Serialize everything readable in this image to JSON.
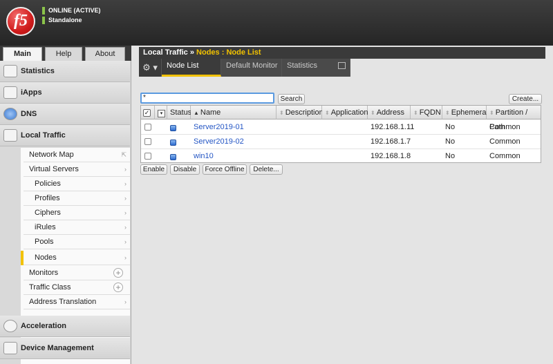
{
  "header": {
    "logo_text": "f5",
    "status": "ONLINE (ACTIVE)",
    "mode": "Standalone"
  },
  "left_tabs": [
    "Main",
    "Help",
    "About"
  ],
  "sidebar": {
    "sections": [
      {
        "label": "Statistics",
        "icon": "statistics-icon"
      },
      {
        "label": "iApps",
        "icon": "iapps-icon"
      },
      {
        "label": "DNS",
        "icon": "dns-globe-icon"
      },
      {
        "label": "Local Traffic",
        "icon": "local-traffic-icon"
      },
      {
        "label": "Acceleration",
        "icon": "acceleration-icon"
      },
      {
        "label": "Device Management",
        "icon": "device-management-icon"
      }
    ],
    "local_traffic_items": [
      {
        "label": "Network Map",
        "sub": false
      },
      {
        "label": "Virtual Servers",
        "sub": false
      },
      {
        "label": "Policies",
        "sub": true
      },
      {
        "label": "Profiles",
        "sub": true
      },
      {
        "label": "Ciphers",
        "sub": true
      },
      {
        "label": "iRules",
        "sub": true
      },
      {
        "label": "Pools",
        "sub": true
      },
      {
        "label": "Nodes",
        "sub": true
      },
      {
        "label": "Monitors",
        "sub": false
      },
      {
        "label": "Traffic Class",
        "sub": false
      },
      {
        "label": "Address Translation",
        "sub": false
      }
    ]
  },
  "breadcrumb": {
    "root": "Local Traffic",
    "sep": "»",
    "current": "Nodes : Node List"
  },
  "tabs": [
    "Node List",
    "Default Monitor",
    "Statistics"
  ],
  "toolbar": {
    "filter_value": "*",
    "search_label": "Search",
    "create_label": "Create..."
  },
  "table": {
    "columns": [
      "Status",
      "Name",
      "Description",
      "Application",
      "Address",
      "FQDN",
      "Ephemeral",
      "Partition / Path"
    ],
    "rows": [
      {
        "name": "Server2019-01",
        "description": "",
        "application": "",
        "address": "192.168.1.11",
        "fqdn": "",
        "ephemeral": "No",
        "partition": "Common"
      },
      {
        "name": "Server2019-02",
        "description": "",
        "application": "",
        "address": "192.168.1.7",
        "fqdn": "",
        "ephemeral": "No",
        "partition": "Common"
      },
      {
        "name": "win10",
        "description": "",
        "application": "",
        "address": "192.168.1.8",
        "fqdn": "",
        "ephemeral": "No",
        "partition": "Common"
      }
    ]
  },
  "actions": [
    "Enable",
    "Disable",
    "Force Offline",
    "Delete..."
  ],
  "colors": {
    "accent": "#f2c200",
    "link": "#2355c4",
    "status_online": "#8bc34a"
  }
}
